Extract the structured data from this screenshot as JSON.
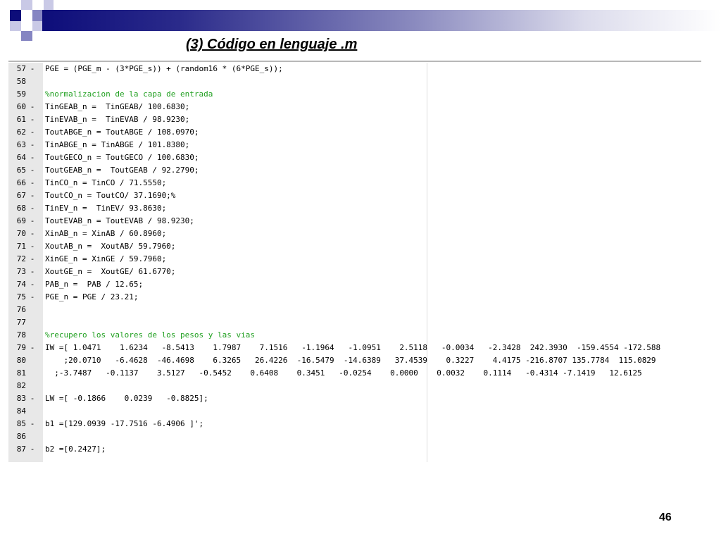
{
  "title": "(3) Código en lenguaje .m",
  "page_number": "46",
  "editor": {
    "lines": [
      {
        "num": "57",
        "mark": "-",
        "code": "PGE = (PGE_m - (3*PGE_s)) + (random16 * (6*PGE_s));",
        "type": "code"
      },
      {
        "num": "58",
        "mark": "",
        "code": "",
        "type": "code"
      },
      {
        "num": "59",
        "mark": "",
        "code": "%normalizacion de la capa de entrada",
        "type": "comment"
      },
      {
        "num": "60",
        "mark": "-",
        "code": "TinGEAB_n =  TinGEAB/ 100.6830;",
        "type": "code"
      },
      {
        "num": "61",
        "mark": "-",
        "code": "TinEVAB_n =  TinEVAB / 98.9230;",
        "type": "code"
      },
      {
        "num": "62",
        "mark": "-",
        "code": "ToutABGE_n = ToutABGE / 108.0970;",
        "type": "code"
      },
      {
        "num": "63",
        "mark": "-",
        "code": "TinABGE_n = TinABGE / 101.8380;",
        "type": "code"
      },
      {
        "num": "64",
        "mark": "-",
        "code": "ToutGECO_n = ToutGECO / 100.6830;",
        "type": "code"
      },
      {
        "num": "65",
        "mark": "-",
        "code": "ToutGEAB_n =  ToutGEAB / 92.2790;",
        "type": "code"
      },
      {
        "num": "66",
        "mark": "-",
        "code": "TinCO_n = TinCO / 71.5550;",
        "type": "code"
      },
      {
        "num": "67",
        "mark": "-",
        "code": "ToutCO_n = ToutCO/ 37.1690;%",
        "type": "code"
      },
      {
        "num": "68",
        "mark": "-",
        "code": "TinEV_n =  TinEV/ 93.8630;",
        "type": "code"
      },
      {
        "num": "69",
        "mark": "-",
        "code": "ToutEVAB_n = ToutEVAB / 98.9230;",
        "type": "code"
      },
      {
        "num": "70",
        "mark": "-",
        "code": "XinAB_n = XinAB / 60.8960;",
        "type": "code"
      },
      {
        "num": "71",
        "mark": "-",
        "code": "XoutAB_n =  XoutAB/ 59.7960;",
        "type": "code"
      },
      {
        "num": "72",
        "mark": "-",
        "code": "XinGE_n = XinGE / 59.7960;",
        "type": "code"
      },
      {
        "num": "73",
        "mark": "-",
        "code": "XoutGE_n =  XoutGE/ 61.6770;",
        "type": "code"
      },
      {
        "num": "74",
        "mark": "-",
        "code": "PAB_n =  PAB / 12.65;",
        "type": "code"
      },
      {
        "num": "75",
        "mark": "-",
        "code": "PGE_n = PGE / 23.21;",
        "type": "code"
      },
      {
        "num": "76",
        "mark": "",
        "code": "",
        "type": "code"
      },
      {
        "num": "77",
        "mark": "",
        "code": "",
        "type": "code"
      },
      {
        "num": "78",
        "mark": "",
        "code": "%recupero los valores de los pesos y las vias",
        "type": "comment"
      },
      {
        "num": "79",
        "mark": "-",
        "code": "IW =[ 1.0471    1.6234   -8.5413    1.7987    7.1516   -1.1964   -1.0951    2.5118   -0.0034   -2.3428  242.3930  -159.4554 -172.588",
        "type": "code"
      },
      {
        "num": "80",
        "mark": "",
        "code": "    ;20.0710   -6.4628  -46.4698    6.3265   26.4226  -16.5479  -14.6389   37.4539    0.3227    4.4175 -216.8707 135.7784  115.0829",
        "type": "code"
      },
      {
        "num": "81",
        "mark": "",
        "code": "  ;-3.7487   -0.1137    3.5127   -0.5452    0.6408    0.3451   -0.0254    0.0000    0.0032    0.1114   -0.4314 -7.1419   12.6125",
        "type": "code"
      },
      {
        "num": "82",
        "mark": "",
        "code": "",
        "type": "code"
      },
      {
        "num": "83",
        "mark": "-",
        "code": "LW =[ -0.1866    0.0239   -0.8825];",
        "type": "code"
      },
      {
        "num": "84",
        "mark": "",
        "code": "",
        "type": "code"
      },
      {
        "num": "85",
        "mark": "-",
        "code": "b1 =[129.0939 -17.7516 -6.4906 ]';",
        "type": "code"
      },
      {
        "num": "86",
        "mark": "",
        "code": "",
        "type": "code"
      },
      {
        "num": "87",
        "mark": "-",
        "code": "b2 =[0.2427];",
        "type": "code"
      }
    ]
  }
}
